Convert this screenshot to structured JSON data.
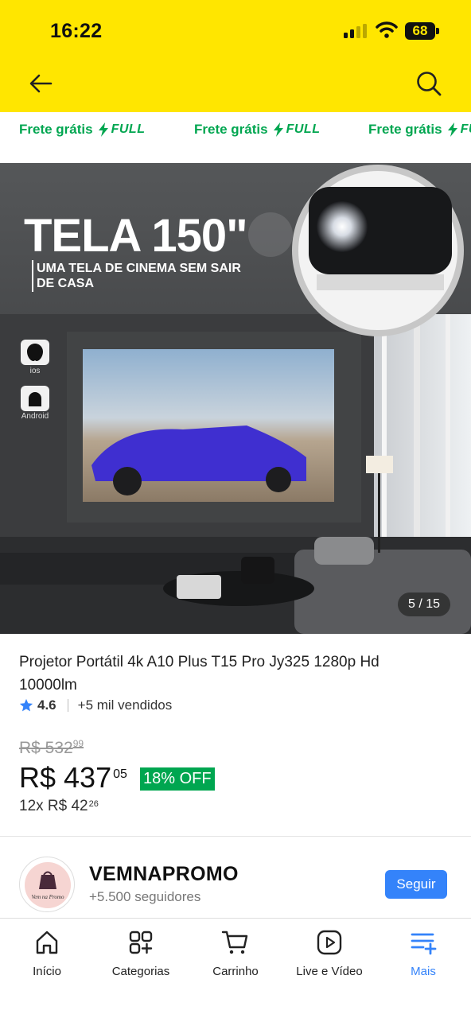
{
  "status_bar": {
    "time": "16:22",
    "battery": "68"
  },
  "header": {
    "back_icon": "arrow-left-icon",
    "search_icon": "search-icon"
  },
  "shipping_strip": [
    {
      "text": "Frete grátis",
      "badge": "FULL"
    },
    {
      "text": "Frete grátis",
      "badge": "FULL"
    },
    {
      "text": "Frete grátis",
      "badge": "FULL"
    }
  ],
  "product_image": {
    "headline": "TELA 150\"",
    "subline_1": "UMA TELA DE CINEMA SEM SAIR",
    "subline_2": "DE CASA",
    "platform_ios": "ios",
    "platform_android": "Android",
    "counter": "5 / 15"
  },
  "product": {
    "title": "Projetor Portátil 4k A10 Plus T15 Pro Jy325 1280p Hd 10000lm",
    "rating": "4.6",
    "sold": "+5 mil vendidos",
    "old_price": "R$ 532",
    "old_price_cents": "99",
    "price": "R$ 437",
    "price_cents": "05",
    "discount": "18% OFF",
    "installments": "12x R$ 42",
    "installments_cents": "26"
  },
  "seller": {
    "name": "VEMNAPROMO",
    "followers": "+5.500 seguidores",
    "logo_text": "Vem na Promo",
    "follow_label": "Seguir"
  },
  "bottom_nav": [
    {
      "label": "Início",
      "icon": "home-icon"
    },
    {
      "label": "Categorias",
      "icon": "categories-icon"
    },
    {
      "label": "Carrinho",
      "icon": "cart-icon"
    },
    {
      "label": "Live e Vídeo",
      "icon": "video-icon"
    },
    {
      "label": "Mais",
      "icon": "menu-plus-icon",
      "active": true
    }
  ],
  "colors": {
    "header": "#FFE600",
    "accent": "#3483FA",
    "green": "#00A650"
  }
}
